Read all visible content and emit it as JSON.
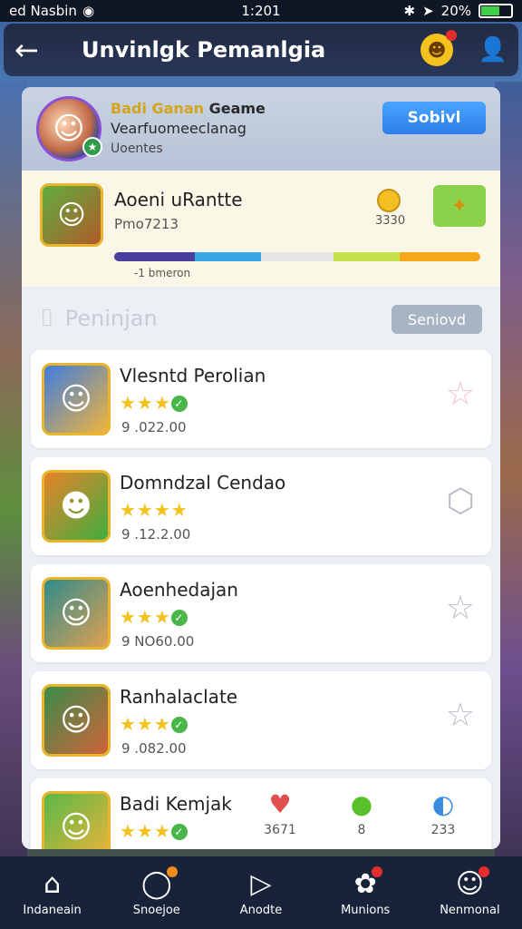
{
  "status": {
    "carrier": "ed Nasbin",
    "time": "1:201",
    "battery": "20%"
  },
  "header": {
    "title": "Unvinlgk Pemanlgia"
  },
  "profile": {
    "name_prefix": "Badi Ganan",
    "name_suffix": "Geame",
    "line1": "Vearfuomeeclanag",
    "line2": "Uoentes",
    "button": "Sobivl"
  },
  "current": {
    "name": "Aoeni uRantte",
    "sub": "Pmo7213",
    "coin_value": "3330",
    "progress_label": "-1 bmeron"
  },
  "section": {
    "title": "Peninjan",
    "button": "Seniovd"
  },
  "rows": [
    {
      "name": "Vlesntd Perolian",
      "value": "9 .022.00"
    },
    {
      "name": "Domndzal Cendao",
      "value": "9 .12.2.00"
    },
    {
      "name": "Aoenhedajan",
      "value": "9 NO60.00"
    },
    {
      "name": "Ranhalaclate",
      "value": "9 .082.00"
    },
    {
      "name": "Badi Kemjak"
    }
  ],
  "extras": [
    {
      "value": "3671"
    },
    {
      "value": "8"
    },
    {
      "value": "233"
    }
  ],
  "tabs": [
    {
      "label": "Indaneain"
    },
    {
      "label": "Snoejoe"
    },
    {
      "label": "Anodte"
    },
    {
      "label": "Munions"
    },
    {
      "label": "Nenmonal"
    }
  ],
  "icons": {
    "back": "back-arrow-icon",
    "header_badge": "emblem-icon",
    "user": "user-icon",
    "section": "list-icon"
  },
  "colors": {
    "accent_blue": "#2c7ee8",
    "tabbar": "#18233a",
    "star": "#f2c21e",
    "badge": "#e52d2d"
  }
}
